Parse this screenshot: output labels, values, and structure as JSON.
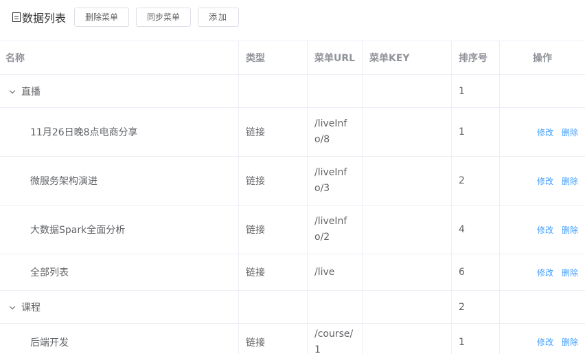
{
  "header": {
    "title": "数据列表",
    "buttons": {
      "delete_menu": "删除菜单",
      "sync_menu": "同步菜单",
      "add": "添加"
    }
  },
  "table": {
    "columns": {
      "name": "名称",
      "type": "类型",
      "url": "菜单URL",
      "key": "菜单KEY",
      "sort": "排序号",
      "ops": "操作"
    },
    "ops": {
      "edit": "修改",
      "delete": "删除"
    },
    "rows": [
      {
        "name": "直播",
        "type": "",
        "url": "",
        "key": "",
        "sort": "1"
      },
      {
        "name": "11月26日晚8点电商分享",
        "type": "链接",
        "url": "/liveInfo/8",
        "key": "",
        "sort": "1"
      },
      {
        "name": "微服务架构演进",
        "type": "链接",
        "url": "/liveInfo/3",
        "key": "",
        "sort": "2"
      },
      {
        "name": "大数据Spark全面分析",
        "type": "链接",
        "url": "/liveInfo/2",
        "key": "",
        "sort": "4"
      },
      {
        "name": "全部列表",
        "type": "链接",
        "url": "/live",
        "key": "",
        "sort": "6"
      },
      {
        "name": "课程",
        "type": "",
        "url": "",
        "key": "",
        "sort": "2"
      },
      {
        "name": "后端开发",
        "type": "链接",
        "url": "/course/1",
        "key": "",
        "sort": "1"
      }
    ]
  }
}
